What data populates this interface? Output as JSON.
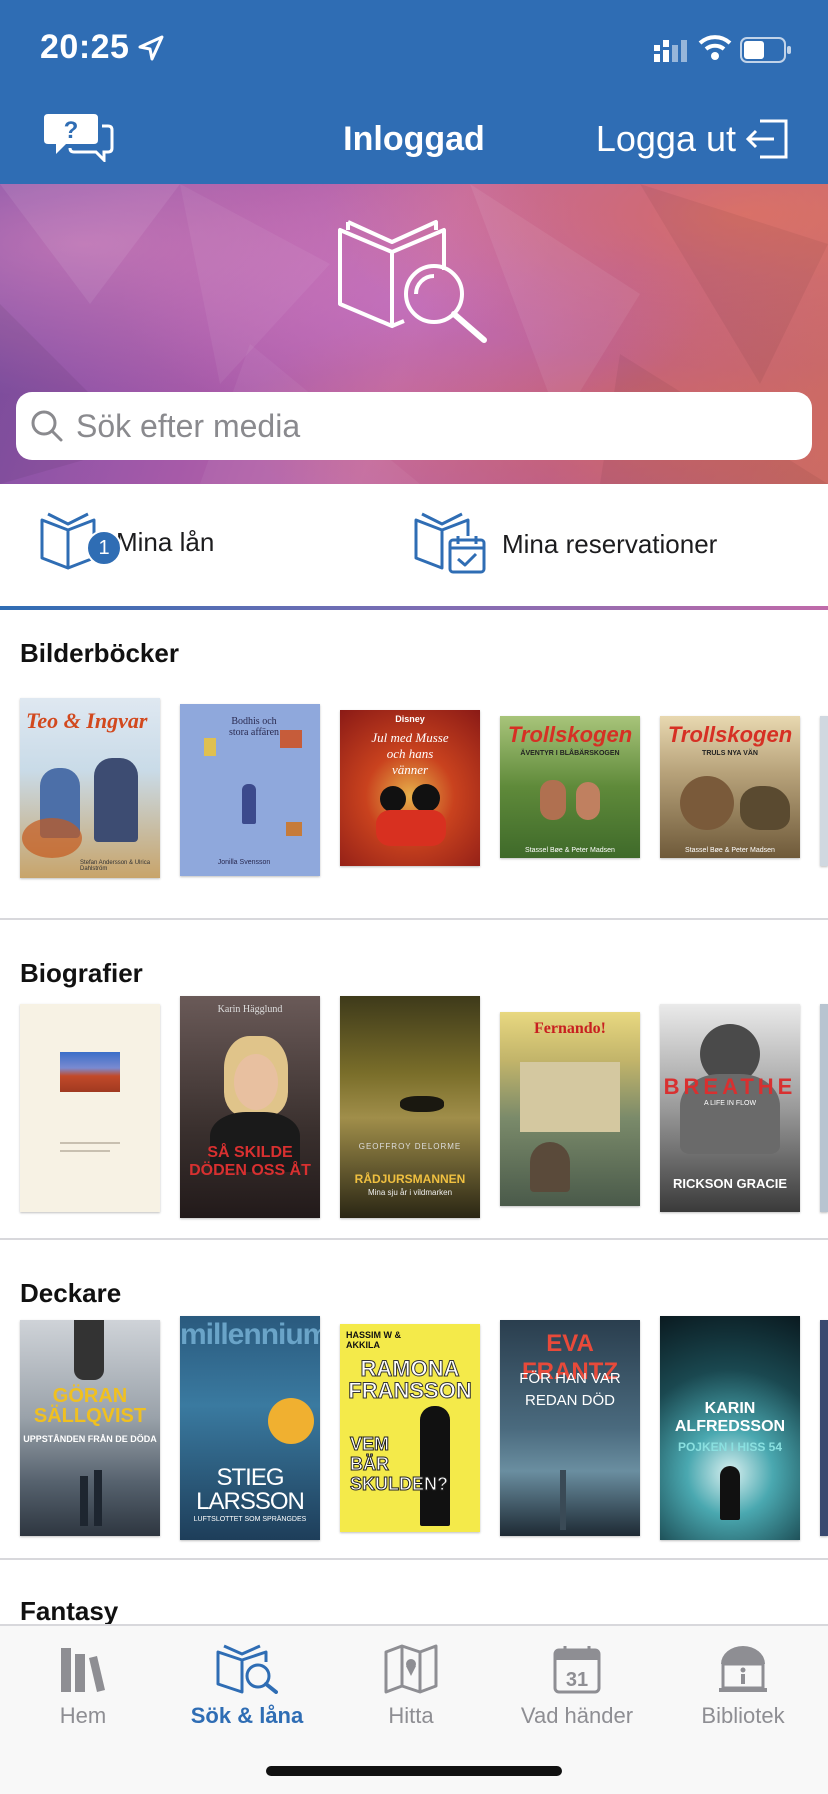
{
  "status_bar": {
    "time": "20:25"
  },
  "nav": {
    "title": "Inloggad",
    "logout_label": "Logga ut"
  },
  "search": {
    "placeholder": "Sök efter media"
  },
  "quick_links": [
    {
      "label": "Mina lån",
      "badge": "1"
    },
    {
      "label": "Mina reservationer"
    }
  ],
  "sections": [
    {
      "title": "Bilderböcker",
      "covers": [
        {
          "title": "Teo & Ingvar",
          "author": "Stefan Andersson & Ulrica Dahlström"
        },
        {
          "title": "Bodhis och stora affären",
          "author": "Jonilla Svensson"
        },
        {
          "title": "Jul med Musse och hans vänner",
          "brand": "Disney"
        },
        {
          "title": "Trollskogen",
          "subtitle": "ÄVENTYR I BLÅBÄRSKOGEN",
          "author": "Stassel Bøe & Peter Madsen"
        },
        {
          "title": "Trollskogen",
          "subtitle": "TRULS NYA VÄN",
          "author": "Stassel Bøe & Peter Madsen"
        }
      ]
    },
    {
      "title": "Biografier",
      "covers": [
        {
          "title": "",
          "author": ""
        },
        {
          "title": "SÅ SKILDE DÖDEN OSS ÅT",
          "author": "Karin Hägglund"
        },
        {
          "title": "RÅDJURSMANNEN",
          "subtitle": "Mina sju år i vildmarken",
          "author": "GEOFFROY DELORME"
        },
        {
          "title": "Fernando!",
          "author": ""
        },
        {
          "title": "BREATHE",
          "subtitle": "A LIFE IN FLOW",
          "author": "RICKSON GRACIE"
        }
      ]
    },
    {
      "title": "Deckare",
      "covers": [
        {
          "title": "UPPSTÅNDEN FRÅN DE DÖDA",
          "author": "GÖRAN SÄLLQVIST"
        },
        {
          "title": "LUFTSLOTTET SOM SPRÄNGDES",
          "author": "STIEG LARSSON",
          "brand": "millennium"
        },
        {
          "title": "RAMONA FRANSSON",
          "subtitle": "VEM BÄR SKULDEN?",
          "author": "HASSIM W & AKKILA"
        },
        {
          "title": "FÖR HAN VAR REDAN DÖD",
          "author": "EVA FRANTZ"
        },
        {
          "title": "POJKEN I HISS 54",
          "author": "KARIN ALFREDSSON"
        }
      ]
    },
    {
      "title": "Fantasy",
      "covers": []
    }
  ],
  "tabs": [
    {
      "label": "Hem",
      "active": false
    },
    {
      "label": "Sök & låna",
      "active": true
    },
    {
      "label": "Hitta",
      "active": false
    },
    {
      "label": "Vad händer",
      "active": false
    },
    {
      "label": "Bibliotek",
      "active": false
    }
  ],
  "calendar_day": "31",
  "colors": {
    "brand_blue": "#2f6db4",
    "tab_inactive": "#8e8e93"
  }
}
